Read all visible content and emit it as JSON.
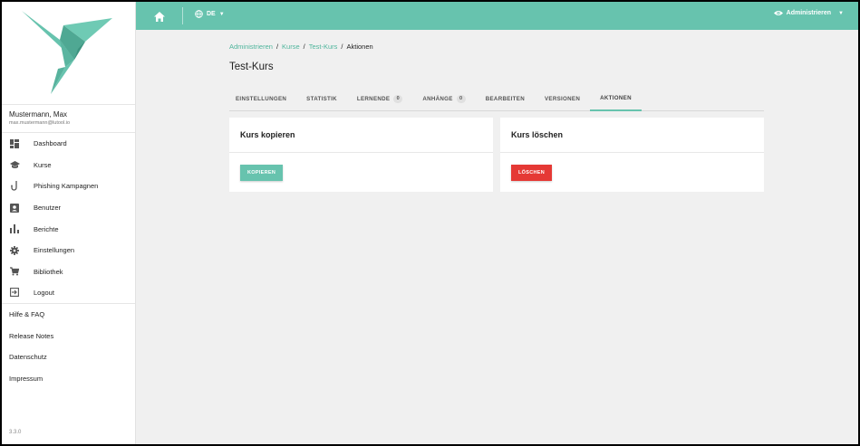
{
  "user": {
    "name": "Mustermann, Max",
    "email": "max.mustermann@lutool.io"
  },
  "sidebar": {
    "items": [
      {
        "label": "Dashboard",
        "icon": "dashboard-icon"
      },
      {
        "label": "Kurse",
        "icon": "school-icon"
      },
      {
        "label": "Phishing Kampagnen",
        "icon": "hook-icon"
      },
      {
        "label": "Benutzer",
        "icon": "user-box-icon"
      },
      {
        "label": "Berichte",
        "icon": "bar-chart-icon"
      },
      {
        "label": "Einstellungen",
        "icon": "gear-icon"
      },
      {
        "label": "Bibliothek",
        "icon": "cart-icon"
      },
      {
        "label": "Logout",
        "icon": "logout-icon"
      }
    ],
    "links": [
      "Hilfe & FAQ",
      "Release Notes",
      "Datenschutz",
      "Impressum"
    ],
    "version": "3.3.0"
  },
  "topbar": {
    "lang": "DE",
    "role": "Administrieren"
  },
  "breadcrumb": [
    "Administrieren",
    "Kurse",
    "Test-Kurs",
    "Aktionen"
  ],
  "page_title": "Test-Kurs",
  "tabs": [
    {
      "label": "EINSTELLUNGEN"
    },
    {
      "label": "STATISTIK"
    },
    {
      "label": "LERNENDE",
      "badge": "0"
    },
    {
      "label": "ANHÄNGE",
      "badge": "0"
    },
    {
      "label": "BEARBEITEN"
    },
    {
      "label": "VERSIONEN"
    },
    {
      "label": "AKTIONEN",
      "active": true
    }
  ],
  "cards": {
    "copy": {
      "title": "Kurs kopieren",
      "button": "KOPIEREN"
    },
    "delete": {
      "title": "Kurs löschen",
      "button": "LÖSCHEN"
    }
  },
  "colors": {
    "primary": "#67c3ae",
    "danger": "#e53935"
  }
}
